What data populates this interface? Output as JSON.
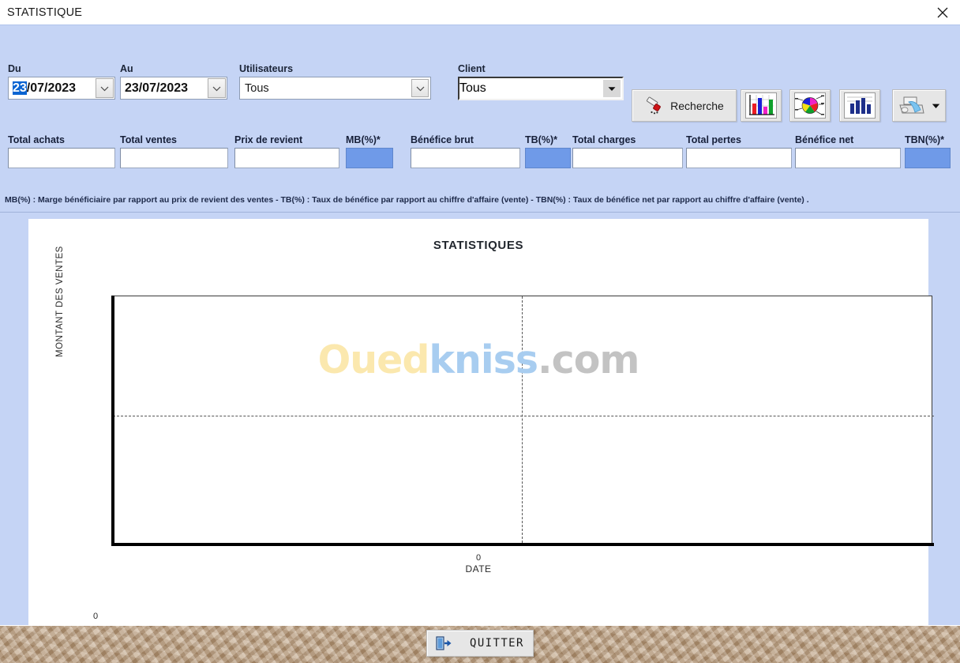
{
  "window": {
    "title": "STATISTIQUE",
    "close_icon": "close-icon"
  },
  "filters": {
    "du": {
      "label": "Du",
      "value_selected": "23",
      "value_rest": "/07/2023"
    },
    "au": {
      "label": "Au",
      "value": "23/07/2023"
    },
    "utilisateurs": {
      "label": "Utilisateurs",
      "value": "Tous"
    },
    "client": {
      "label": "Client",
      "value": "Tous"
    }
  },
  "toolbar": {
    "recherche": {
      "label": "Recherche",
      "icon": "brush-search-icon"
    },
    "bar_chart": {
      "icon": "bar-chart-color-icon"
    },
    "pie_chart": {
      "icon": "pie-chart-color-icon"
    },
    "histogram": {
      "icon": "histogram-blue-icon"
    },
    "print": {
      "icon": "printer-icon",
      "dropdown_icon": "caret-down-icon"
    }
  },
  "totals": [
    {
      "label": "Total achats",
      "value": "",
      "style": "white"
    },
    {
      "label": "Total ventes",
      "value": "",
      "style": "white"
    },
    {
      "label": "Prix de revient",
      "value": "",
      "style": "white"
    },
    {
      "label": "MB(%)*",
      "value": "",
      "style": "blue"
    },
    {
      "label": "Bénéfice brut",
      "value": "",
      "style": "white"
    },
    {
      "label": "TB(%)*",
      "value": "",
      "style": "blue"
    },
    {
      "label": "Total charges",
      "value": "",
      "style": "white"
    },
    {
      "label": "Total pertes",
      "value": "",
      "style": "white"
    },
    {
      "label": "Bénéfice net",
      "value": "",
      "style": "white"
    },
    {
      "label": "TBN(%)*",
      "value": "",
      "style": "blue"
    }
  ],
  "note": "MB(%) : Marge bénéficiaire par rapport au prix de revient des ventes  -  TB(%) : Taux de bénéfice par rapport au chiffre d'affaire (vente)  -  TBN(%) : Taux de bénéfice net par rapport au chiffre d'affaire (vente) .",
  "watermark": {
    "part1": "Oued",
    "part2": "kniss",
    "part3": ".com"
  },
  "chart_data": {
    "type": "line",
    "title": "STATISTIQUES",
    "xlabel": "DATE",
    "ylabel": "MONTANT DES VENTES",
    "x": [],
    "series": [],
    "xticks": [
      "0"
    ],
    "yticks": [
      "0"
    ],
    "xlim": [
      0,
      0
    ],
    "ylim": [
      0,
      0
    ],
    "grid": true,
    "legend": "none",
    "empty_state": true
  },
  "footer": {
    "quitter": {
      "label": "QUITTER",
      "icon": "exit-door-icon"
    }
  },
  "colors": {
    "panel_bg": "#c5d4f5",
    "field_blue": "#6f9ae8",
    "selection_blue": "#0a64d2",
    "footer_tan": "#c3a88a"
  }
}
